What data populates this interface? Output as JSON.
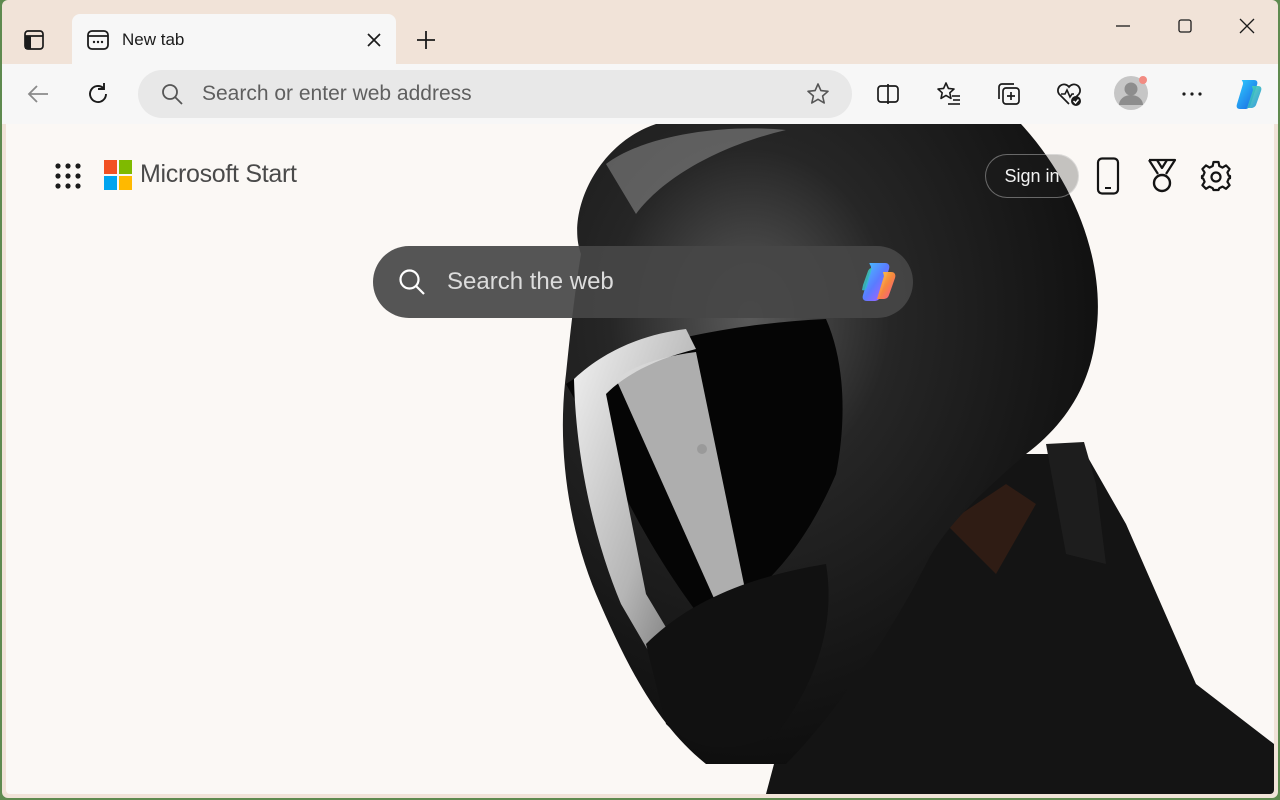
{
  "browser": {
    "tab": {
      "title": "New tab"
    },
    "address_bar": {
      "placeholder": "Search or enter web address"
    }
  },
  "page": {
    "brand": "Microsoft Start",
    "sign_in_label": "Sign in",
    "search": {
      "placeholder": "Search the web"
    }
  },
  "colors": {
    "titlebar": "#f1e3d8",
    "toolbar": "#f7f7f7",
    "page_background": "#fbf8f5",
    "search_box": "#464646"
  },
  "icons": {
    "titlebar": [
      "tab-actions-icon",
      "new-tab-page-icon",
      "close-icon",
      "plus-icon",
      "minimize-icon",
      "maximize-icon",
      "close-window-icon"
    ],
    "toolbar": [
      "back-arrow-icon",
      "refresh-icon",
      "search-icon",
      "star-icon",
      "split-screen-icon",
      "favorites-icon",
      "collections-icon",
      "browser-essentials-icon",
      "profile-avatar-icon",
      "more-icon",
      "copilot-icon"
    ],
    "page": [
      "app-launcher-icon",
      "microsoft-logo",
      "mobile-phone-icon",
      "rewards-medal-icon",
      "settings-gear-icon",
      "copilot-icon"
    ]
  }
}
